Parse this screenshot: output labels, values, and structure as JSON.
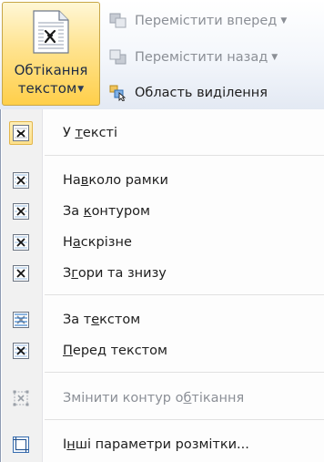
{
  "ribbon": {
    "wrap_text_button": {
      "line1": "Обтікання",
      "line2": "текстом",
      "icon": "wrap-text-icon"
    },
    "commands": [
      {
        "label": "Перемістити вперед",
        "icon": "bring-forward-icon",
        "enabled": false,
        "has_dropdown": true
      },
      {
        "label": "Перемістити назад",
        "icon": "send-backward-icon",
        "enabled": false,
        "has_dropdown": true
      },
      {
        "label": "Область виділення",
        "icon": "selection-pane-icon",
        "enabled": true,
        "has_dropdown": false
      }
    ]
  },
  "menu": {
    "items": [
      {
        "pre": "У ",
        "u": "т",
        "post": "ексті",
        "icon": "in-line-with-text-icon",
        "selected": true,
        "enabled": true
      },
      {
        "pre": "На",
        "u": "в",
        "post": "коло рамки",
        "icon": "square-wrap-icon",
        "selected": false,
        "enabled": true
      },
      {
        "pre": "За ",
        "u": "к",
        "post": "онтуром",
        "icon": "tight-wrap-icon",
        "selected": false,
        "enabled": true
      },
      {
        "pre": "Н",
        "u": "а",
        "post": "скрізне",
        "icon": "through-wrap-icon",
        "selected": false,
        "enabled": true
      },
      {
        "pre": "З",
        "u": "г",
        "post": "ори та знизу",
        "icon": "top-and-bottom-icon",
        "selected": false,
        "enabled": true
      },
      {
        "pre": "За т",
        "u": "е",
        "post": "кстом",
        "icon": "behind-text-icon",
        "selected": false,
        "enabled": true
      },
      {
        "pre": "",
        "u": "П",
        "post": "еред текстом",
        "icon": "in-front-of-text-icon",
        "selected": false,
        "enabled": true
      },
      {
        "pre": "Змінити контур о",
        "u": "б",
        "post": "тікання",
        "icon": "edit-wrap-points-icon",
        "selected": false,
        "enabled": false
      },
      {
        "pre": "І",
        "u": "н",
        "post": "ші параметри розмітки...",
        "icon": "more-layout-options-icon",
        "selected": false,
        "enabled": true
      }
    ]
  }
}
